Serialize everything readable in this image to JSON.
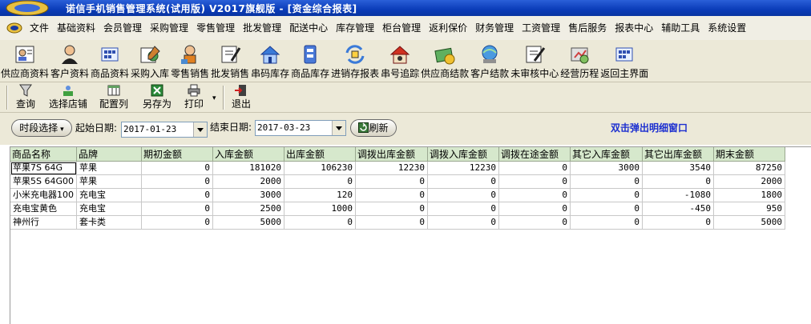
{
  "window": {
    "title": "诺信手机销售管理系统(试用版)  V2017旗舰版 - [资金综合报表]"
  },
  "menu": [
    "文件",
    "基础资料",
    "会员管理",
    "采购管理",
    "零售管理",
    "批发管理",
    "配送中心",
    "库存管理",
    "柜台管理",
    "返利保价",
    "财务管理",
    "工资管理",
    "售后服务",
    "报表中心",
    "辅助工具",
    "系统设置"
  ],
  "toolbar": [
    {
      "label": "供应商资料",
      "icon": "supplier-icon"
    },
    {
      "label": "客户资料",
      "icon": "customer-icon"
    },
    {
      "label": "商品资料",
      "icon": "product-icon"
    },
    {
      "label": "采购入库",
      "icon": "purchase-icon"
    },
    {
      "label": "零售销售",
      "icon": "retail-icon"
    },
    {
      "label": "批发销售",
      "icon": "wholesale-icon"
    },
    {
      "label": "串码库存",
      "icon": "serial-stock-icon"
    },
    {
      "label": "商品库存",
      "icon": "product-stock-icon"
    },
    {
      "label": "进销存报表",
      "icon": "report-icon"
    },
    {
      "label": "串号追踪",
      "icon": "serial-trace-icon"
    },
    {
      "label": "供应商结款",
      "icon": "supplier-payment-icon"
    },
    {
      "label": "客户结款",
      "icon": "customer-payment-icon"
    },
    {
      "label": "未审核中心",
      "icon": "unaudited-icon"
    },
    {
      "label": "经营历程",
      "icon": "history-icon"
    },
    {
      "label": "返回主界面",
      "icon": "home-icon"
    }
  ],
  "subtoolbar": {
    "query": "查询",
    "select_store": "选择店铺",
    "config_columns": "配置列",
    "save_as": "另存为",
    "print": "打印",
    "exit": "退出"
  },
  "filter": {
    "period_select": "时段选择",
    "start_label": "起始日期:",
    "start_date": "2017-01-23",
    "end_label": "结束日期:",
    "end_date": "2017-03-23",
    "refresh": "刷新",
    "hint": "双击弹出明细窗口"
  },
  "table": {
    "columns": [
      "商品名称",
      "品牌",
      "期初金额",
      "入库金额",
      "出库金额",
      "调拨出库金额",
      "调拨入库金额",
      "调拨在途金额",
      "其它入库金额",
      "其它出库金额",
      "期末金额"
    ],
    "rows": [
      [
        "苹果7S 64G",
        "苹果",
        "0",
        "181020",
        "106230",
        "12230",
        "12230",
        "0",
        "3000",
        "3540",
        "87250"
      ],
      [
        "苹果5S 64G00",
        "苹果",
        "0",
        "2000",
        "0",
        "0",
        "0",
        "0",
        "0",
        "0",
        "2000"
      ],
      [
        "小米充电器100",
        "充电宝",
        "0",
        "3000",
        "120",
        "0",
        "0",
        "0",
        "0",
        "-1080",
        "1800"
      ],
      [
        "充电宝黄色",
        "充电宝",
        "0",
        "2500",
        "1000",
        "0",
        "0",
        "0",
        "0",
        "-450",
        "950"
      ],
      [
        "神州行",
        "套卡类",
        "0",
        "5000",
        "0",
        "0",
        "0",
        "0",
        "0",
        "0",
        "5000"
      ]
    ]
  },
  "colors": {
    "title_bar": "#0a3cb8",
    "grid_header": "#d6e8cc",
    "hint": "#1c2fd0"
  }
}
